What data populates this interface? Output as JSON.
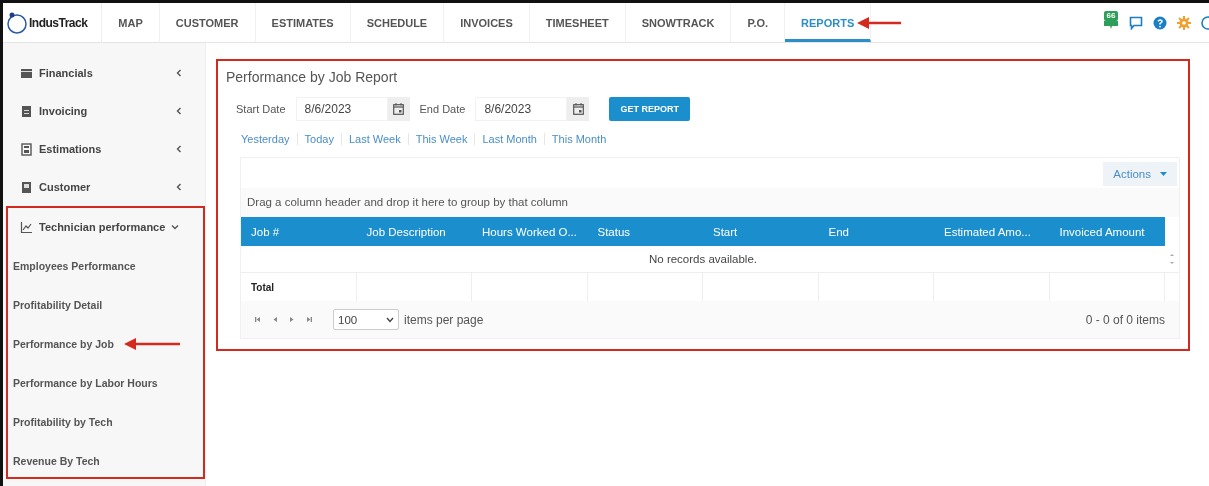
{
  "top_nav": {
    "logo": "IndusTrack",
    "tabs": [
      {
        "label": "MAP",
        "selected": false,
        "annotated": false
      },
      {
        "label": "CUSTOMER",
        "selected": false,
        "annotated": false
      },
      {
        "label": "ESTIMATES",
        "selected": false,
        "annotated": false
      },
      {
        "label": "SCHEDULE",
        "selected": false,
        "annotated": false
      },
      {
        "label": "INVOICES",
        "selected": false,
        "annotated": false
      },
      {
        "label": "TIMESHEET",
        "selected": false,
        "annotated": false
      },
      {
        "label": "SNOWTRACK",
        "selected": false,
        "annotated": false
      },
      {
        "label": "P.O.",
        "selected": false,
        "annotated": false
      },
      {
        "label": "REPORTS",
        "selected": true,
        "annotated": true
      }
    ],
    "notification_count": "66"
  },
  "sidebar": {
    "items": [
      {
        "label": "Financials",
        "expanded": false,
        "annotated": false
      },
      {
        "label": "Invoicing",
        "expanded": false,
        "annotated": false
      },
      {
        "label": "Estimations",
        "expanded": false,
        "annotated": false
      },
      {
        "label": "Customer",
        "expanded": false,
        "annotated": false
      },
      {
        "label": "Technician performance",
        "expanded": true,
        "annotated": true,
        "children": [
          {
            "label": "Employees Performance",
            "annotated": false
          },
          {
            "label": "Profitability Detail",
            "annotated": false
          },
          {
            "label": "Performance by Job",
            "annotated": true
          },
          {
            "label": "Performance by Labor Hours",
            "annotated": false
          },
          {
            "label": "Profitability by Tech",
            "annotated": false
          },
          {
            "label": "Revenue By Tech",
            "annotated": false
          }
        ]
      }
    ]
  },
  "report": {
    "title": "Performance by Job Report",
    "annotated": true,
    "start_date": {
      "label": "Start Date",
      "value": "8/6/2023"
    },
    "end_date": {
      "label": "End Date",
      "value": "8/6/2023"
    },
    "get_report_button": "GET REPORT",
    "quick_ranges": [
      "Yesterday",
      "Today",
      "Last Week",
      "This Week",
      "Last Month",
      "This Month"
    ],
    "actions_button": "Actions",
    "group_hint": "Drag a column header and drop it here to group by that column",
    "columns": [
      "Job #",
      "Job Description",
      "Hours Worked O...",
      "Status",
      "Start",
      "End",
      "Estimated Amo...",
      "Invoiced Amount"
    ],
    "empty_message": "No records available.",
    "footer_label": "Total",
    "page_size": "100",
    "page_size_label": "items per page",
    "pager_info": "0 - 0 of 0 items"
  }
}
